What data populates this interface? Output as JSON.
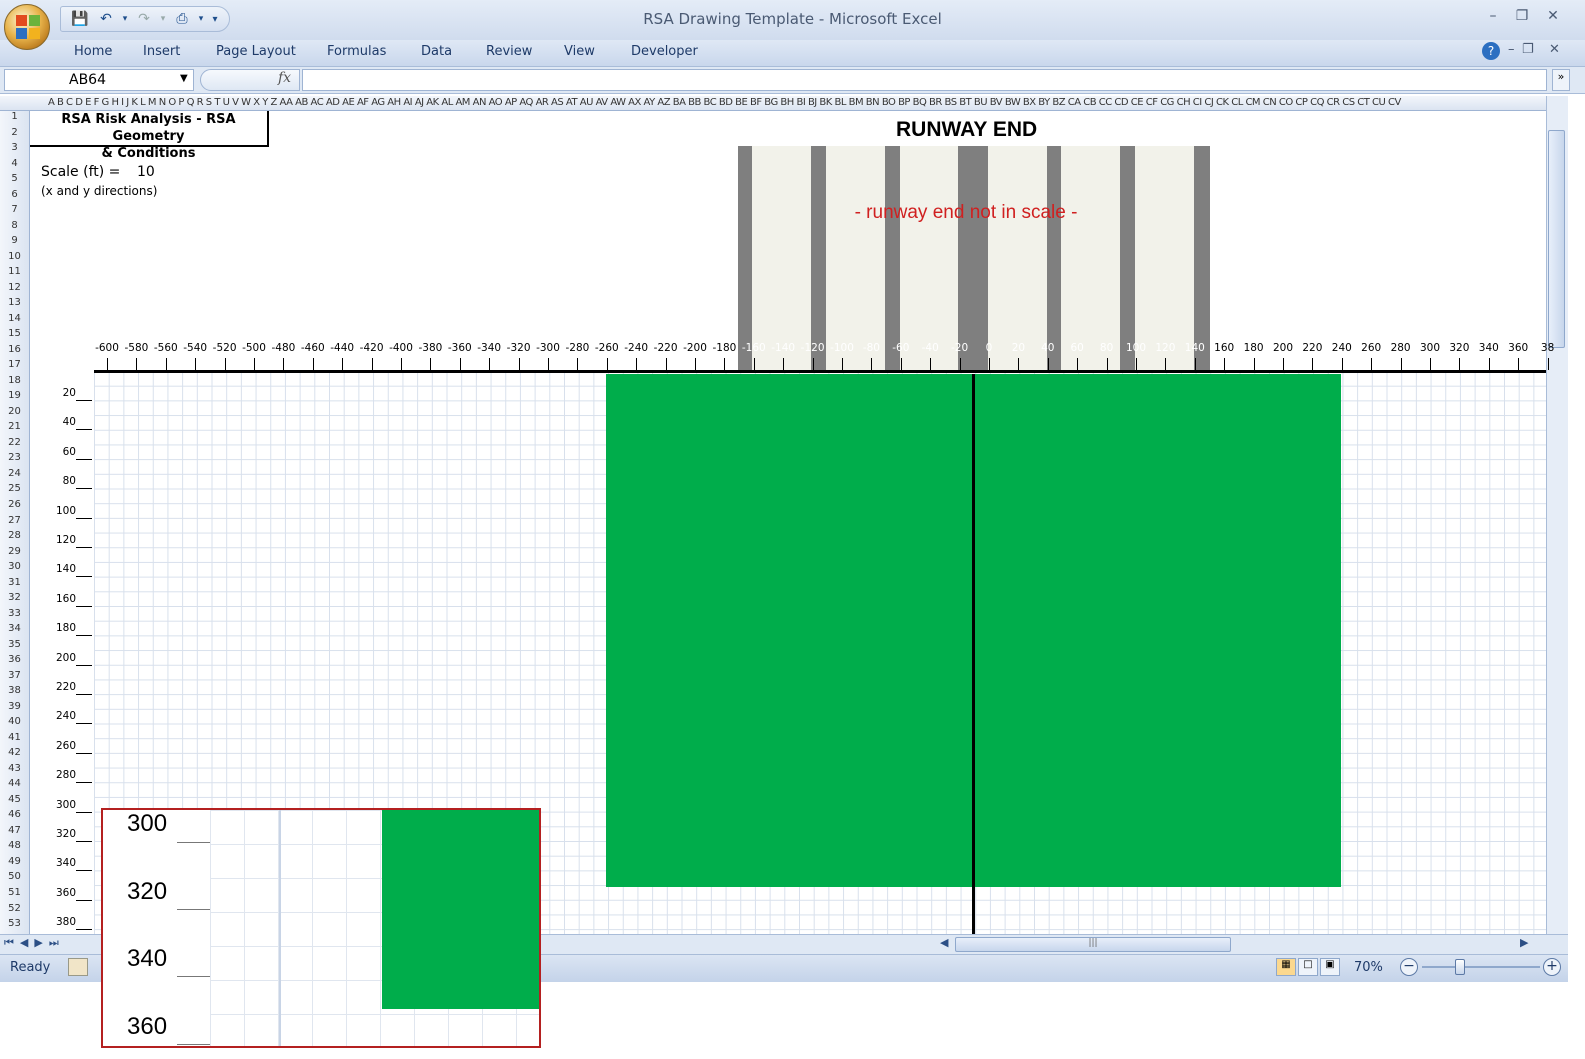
{
  "window": {
    "title": "RSA Drawing Template - Microsoft Excel"
  },
  "ribbon": {
    "tabs": [
      "Home",
      "Insert",
      "Page Layout",
      "Formulas",
      "Data",
      "Review",
      "View",
      "Developer"
    ]
  },
  "formula_bar": {
    "name_box": "AB64",
    "fx": "fx",
    "content": ""
  },
  "sheet": {
    "col_headers": "A  B C D E F G H I J K L M N O P Q R S T U V W X Y Z AA AB AC AD AE AF AG AH AI AJ AK AL AM AN AO AP AQ AR AS AT AU AV AW AX AY AZ BA BB BC BD BE BF BG BH BI BJ BK BL BM BN BO BP BQ BR BS BT BU BV BW BX BY BZ CA CB CC CD CE CF CG CH CI CJ CK CL CM CN CO CP CQ CR CS CT CU CV",
    "rows": [
      "1",
      "2",
      "3",
      "4",
      "5",
      "6",
      "7",
      "8",
      "9",
      "10",
      "11",
      "12",
      "13",
      "14",
      "15",
      "16",
      "17",
      "18",
      "19",
      "20",
      "21",
      "22",
      "23",
      "24",
      "25",
      "26",
      "27",
      "28",
      "29",
      "30",
      "31",
      "32",
      "33",
      "34",
      "35",
      "36",
      "37",
      "38",
      "39",
      "40",
      "41",
      "42",
      "43",
      "44",
      "45",
      "46",
      "47",
      "48",
      "49",
      "50",
      "51",
      "52",
      "53"
    ],
    "label_line1": "RSA Risk Analysis - RSA Geometry",
    "label_line2": "& Conditions",
    "scale_label": "Scale (ft) =",
    "scale_value": "10",
    "scale_note": "(x and y directions)",
    "runway_title": "RUNWAY END",
    "runway_note": "- runway end not in scale -",
    "x_axis_ticks": [
      "-600",
      "-580",
      "-560",
      "-540",
      "-520",
      "-500",
      "-480",
      "-460",
      "-440",
      "-420",
      "-400",
      "-380",
      "-360",
      "-340",
      "-320",
      "-300",
      "-280",
      "-260",
      "-240",
      "-220",
      "-200",
      "-180",
      "-160",
      "-140",
      "-120",
      "-100",
      "-80",
      "-60",
      "-40",
      "-20",
      "0",
      "20",
      "40",
      "60",
      "80",
      "100",
      "120",
      "140",
      "160",
      "180",
      "200",
      "220",
      "240",
      "260",
      "280",
      "300",
      "320",
      "340",
      "360",
      "38"
    ],
    "y_axis_ticks": [
      "20",
      "40",
      "60",
      "80",
      "100",
      "120",
      "140",
      "160",
      "180",
      "200",
      "220",
      "240",
      "260",
      "280",
      "300",
      "320",
      "340",
      "360",
      "380"
    ]
  },
  "colors": {
    "rsa_area": "#00ad4b",
    "runway": "#7f7f7f",
    "runway_stripe": "#f2f2ea",
    "note": "#d02020"
  },
  "statusbar": {
    "status": "Ready",
    "zoom": "70%"
  },
  "inset": {
    "labels": [
      "300",
      "320",
      "340",
      "360"
    ]
  }
}
